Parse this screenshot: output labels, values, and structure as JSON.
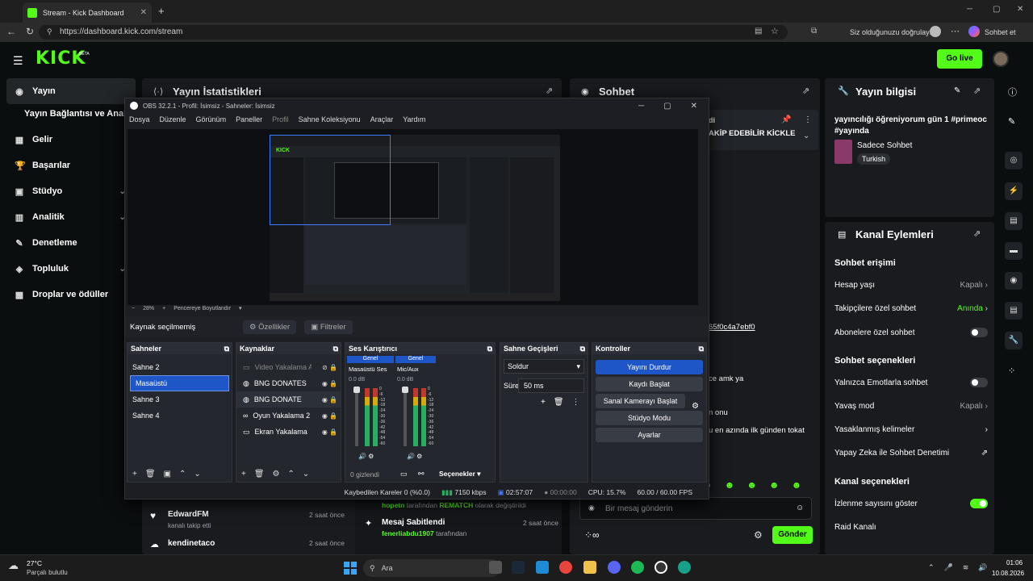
{
  "browser": {
    "tab_title": "Stream - Kick Dashboard",
    "url": "https://dashboard.kick.com/stream",
    "signed_in_text": "Siz olduğunuzu doğrulayın",
    "chat_btn": "Sohbet et"
  },
  "kick": {
    "logo": "KICK",
    "beta": "BETA",
    "go_live": "Go live"
  },
  "sidebar": [
    {
      "label": "Yayın",
      "icon": "broadcast-icon"
    },
    {
      "label": "Yayın Bağlantısı ve Anahtarı",
      "icon": ""
    },
    {
      "label": "Gelir",
      "icon": "dollar-icon"
    },
    {
      "label": "Başarılar",
      "icon": "trophy-icon"
    },
    {
      "label": "Stüdyo",
      "icon": "studio-icon"
    },
    {
      "label": "Analitik",
      "icon": "chart-icon"
    },
    {
      "label": "Denetleme",
      "icon": "wrench-icon"
    },
    {
      "label": "Topluluk",
      "icon": "community-icon"
    },
    {
      "label": "Droplar ve ödüller",
      "icon": "gift-icon"
    }
  ],
  "stats": {
    "title": "Yayın İstatistikleri"
  },
  "chat": {
    "title": "Sohbet",
    "pinned_partial": "di",
    "pinned_partial2": "AKİP EDEBİLİR KİCKLE",
    "msg1": "65f0c4a7ebf0",
    "msg2": "ce amk ya",
    "msg3": "n onu",
    "msg4": "u en azında ilk günden tokat",
    "placeholder": "Bir mesaj gönderin",
    "send": "Gönder"
  },
  "info": {
    "title": "Yayın bilgisi",
    "stream_title": "yayıncılığı öğreniyorum gün 1 #primeoc #yayında",
    "category": "Sadece Sohbet",
    "tag": "Turkish"
  },
  "actions": {
    "title": "Kanal Eylemleri",
    "access_header": "Sohbet erişimi",
    "account_age": "Hesap yaşı",
    "account_age_val": "Kapalı",
    "followers_only": "Takipçilere özel sohbet",
    "followers_only_val": "Anında",
    "subs_only": "Abonelere özel sohbet",
    "options_header": "Sohbet seçenekleri",
    "emote_only": "Yalnızca Emotlarla sohbet",
    "slow_mode": "Yavaş mod",
    "slow_mode_val": "Kapalı",
    "banned_words": "Yasaklanmış kelimeler",
    "ai_mod": "Yapay Zeka ile Sohbet Denetimi",
    "channel_header": "Kanal seçenekleri",
    "view_count": "İzlenme sayısını göster",
    "raid": "Raid Kanalı"
  },
  "activity": [
    {
      "name": "EdwardFM",
      "sub": "kanalı takip etti",
      "time": "2 saat önce"
    },
    {
      "name": "kendinetaco",
      "sub": "",
      "time": "2 saat önce"
    }
  ],
  "events": [
    {
      "name": "hopetn",
      "mid": "tarafından",
      "val": "REMATCH",
      "end": "olarak değiştirildi"
    },
    {
      "title": "Mesaj Sabitlendi",
      "name": "fenerliabdu1907",
      "mid": "tarafından",
      "time": "2 saat önce"
    }
  ],
  "obs": {
    "title": "OBS 32.2.1 - Profil: İsimsiz - Sahneler: İsimsiz",
    "menu": [
      "Dosya",
      "Düzenle",
      "Görünüm",
      "Paneller",
      "Profil",
      "Sahne Koleksiyonu",
      "Araçlar",
      "Yardım"
    ],
    "zoom": "28%",
    "fit": "Pencereye Boyutlandır",
    "no_source": "Kaynak seçilmemiş",
    "props": "Özellikler",
    "filters": "Filtreler",
    "scenes_title": "Sahneler",
    "scenes": [
      "Sahne 2",
      "Masaüstü",
      "Sahne 3",
      "Sahne 4"
    ],
    "sources_title": "Kaynaklar",
    "sources": [
      "Video Yakalama Aygıtı",
      "BNG DONATES",
      "BNG DONATE",
      "Oyun Yakalama 2",
      "Ekran Yakalama"
    ],
    "mixer_title": "Ses Karıştırıcı",
    "mixer_channels": [
      {
        "tag": "Genel",
        "name": "Masaüstü Ses",
        "db": "0.0 dB"
      },
      {
        "tag": "Genel",
        "name": "Mic/Aux",
        "db": "0.0 dB"
      }
    ],
    "hidden": "0 gizlendi",
    "options": "Seçenekler",
    "transitions_title": "Sahne Geçişleri",
    "transition": "Soldur",
    "duration_label": "Süre",
    "duration": "50 ms",
    "controls_title": "Kontroller",
    "controls": [
      "Yayını Durdur",
      "Kaydı Başlat",
      "Sanal Kamerayı Başlat",
      "Stüdyo Modu",
      "Ayarlar"
    ],
    "status": {
      "dropped": "Kaybedilen Kareler 0 (%0.0)",
      "kbps": "7150 kbps",
      "time1": "02:57:07",
      "time2": "00:00:00",
      "cpu": "CPU: 15.7%",
      "fps": "60.00 / 60.00 FPS"
    },
    "ticks": [
      "0",
      "-6",
      "-12",
      "-18",
      "-24",
      "-30",
      "-36",
      "-42",
      "-48",
      "-54",
      "-60"
    ]
  },
  "taskbar": {
    "weather_temp": "27°C",
    "weather_desc": "Parçalı bulutlu",
    "search": "Ara",
    "time": "01:06",
    "date": "10.08.2026"
  }
}
